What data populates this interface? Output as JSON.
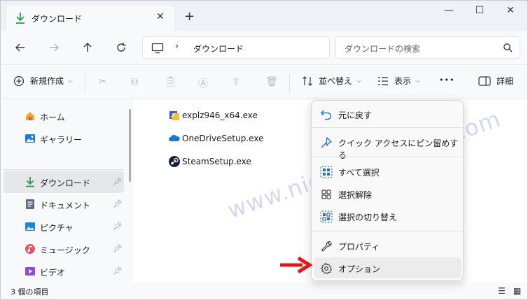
{
  "window": {
    "tab_title": "ダウンロード",
    "tab_close": "✕",
    "new_tab": "+",
    "minimize": "—",
    "maximize": "☐",
    "close": "✕"
  },
  "address": {
    "separator": "›",
    "crumb": "ダウンロード",
    "search_placeholder": "ダウンロードの検索"
  },
  "toolbar": {
    "new_label": "新規作成",
    "sort_label": "並べ替え",
    "view_label": "表示",
    "more": "•••",
    "details_label": "詳細"
  },
  "sidebar": {
    "items": [
      {
        "label": "ホーム",
        "icon": "home-icon"
      },
      {
        "label": "ギャラリー",
        "icon": "gallery-icon"
      },
      {
        "label": "ダウンロード",
        "icon": "download-icon",
        "pinned": true,
        "active": true
      },
      {
        "label": "ドキュメント",
        "icon": "document-icon",
        "pinned": true
      },
      {
        "label": "ピクチャ",
        "icon": "pictures-icon",
        "pinned": true
      },
      {
        "label": "ミュージック",
        "icon": "music-icon",
        "pinned": true
      },
      {
        "label": "ビデオ",
        "icon": "video-icon",
        "pinned": true
      }
    ]
  },
  "files": [
    {
      "name": "explz946_x64.exe",
      "icon": "installer-icon"
    },
    {
      "name": "OneDriveSetup.exe",
      "icon": "onedrive-icon"
    },
    {
      "name": "SteamSetup.exe",
      "icon": "steam-icon"
    }
  ],
  "status": {
    "count": "3 個の項目"
  },
  "context_menu": {
    "items": [
      {
        "label": "元に戻す",
        "icon": "undo-icon"
      },
      {
        "label": "クイック アクセスにピン留めする",
        "icon": "pin-icon"
      },
      {
        "label": "すべて選択",
        "icon": "select-all-icon"
      },
      {
        "label": "選択解除",
        "icon": "select-none-icon"
      },
      {
        "label": "選択の切り替え",
        "icon": "invert-selection-icon"
      },
      {
        "label": "プロパティ",
        "icon": "wrench-icon"
      },
      {
        "label": "オプション",
        "icon": "gear-icon"
      }
    ]
  },
  "watermark": "www.nichepcgamer.com",
  "colors": {
    "accent": "#0067c0",
    "arrow": "#e8141c",
    "download_green": "#1e9e4a"
  }
}
